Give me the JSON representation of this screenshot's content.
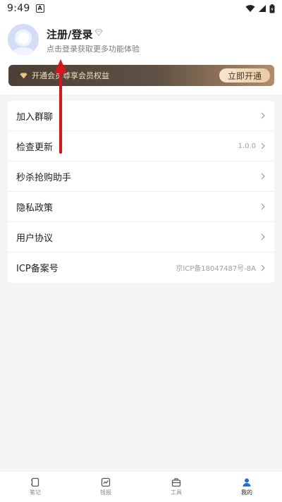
{
  "status_bar": {
    "time": "9:49",
    "notification_letter": "A"
  },
  "header": {
    "login_title": "注册/登录",
    "login_subtitle": "点击登录获取更多功能体验"
  },
  "vip": {
    "text": "开通会员尊享会员权益",
    "button_label": "立即开通",
    "accent": "#f3e0c6"
  },
  "menu": {
    "items": [
      {
        "label": "加入群聊",
        "value": ""
      },
      {
        "label": "检查更新",
        "value": "1.0.0"
      },
      {
        "label": "秒杀抢购助手",
        "value": ""
      },
      {
        "label": "隐私政策",
        "value": ""
      },
      {
        "label": "用户协议",
        "value": ""
      },
      {
        "label": "ICP备案号",
        "value": "京ICP备18047487号-8A"
      }
    ]
  },
  "bottom_nav": {
    "items": [
      {
        "label": "笔记",
        "icon": "note-icon"
      },
      {
        "label": "钱报",
        "icon": "report-icon"
      },
      {
        "label": "工具",
        "icon": "toolbox-icon"
      },
      {
        "label": "我的",
        "icon": "user-icon"
      }
    ],
    "active_index": 3
  },
  "colors": {
    "annotation_arrow": "#d9151b",
    "active_nav": "#1f6fe0"
  }
}
